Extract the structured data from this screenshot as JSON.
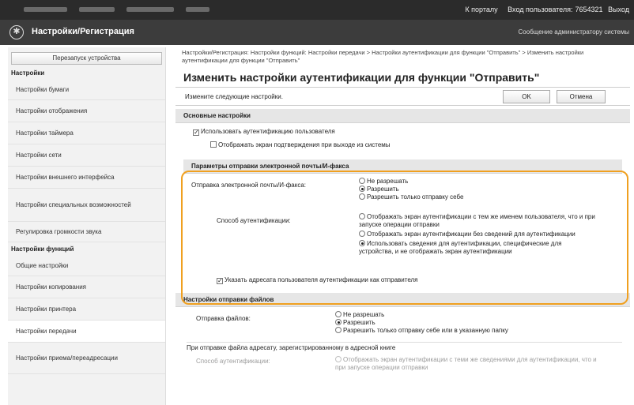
{
  "topbar": {
    "portal_link": "К порталу",
    "login_label": "Вход пользователя:",
    "login_user": "7654321",
    "logout_link": "Выход"
  },
  "app": {
    "title": "Настройки/Регистрация",
    "admin_message": "Сообщение администратору системы"
  },
  "sidebar": {
    "restart_button": "Перезапуск устройства",
    "section1": "Настройки",
    "items1": [
      "Настройки бумаги",
      "Настройки отображения",
      "Настройки таймера",
      "Настройки сети",
      "Настройки внешнего интерфейса",
      "Настройки специальных возможностей",
      "Регулировка громкости звука"
    ],
    "section2": "Настройки функций",
    "items2": [
      "Общие настройки",
      "Настройки копирования",
      "Настройки принтера",
      "Настройки передачи",
      "Настройки приема/переадресации"
    ]
  },
  "main": {
    "breadcrumb": "Настройки/Регистрация: Настройки функций: Настройки передачи > Настройки аутентификации для функции \"Отправить\" > Изменить настройки аутентификации для функции \"Отправить\"",
    "page_title": "Изменить настройки аутентификации для функции \"Отправить\"",
    "instruction": "Измените следующие настройки.",
    "ok_button": "OK",
    "cancel_button": "Отмена",
    "basic": {
      "header": "Основные настройки",
      "use_auth": "Использовать аутентификацию пользователя",
      "show_confirm": "Отображать экран подтверждения при выходе из системы"
    },
    "email": {
      "header": "Параметры отправки электронной почты/И-факса",
      "send_label": "Отправка электронной почты/И-факса:",
      "send_options": [
        "Не разрешать",
        "Разрешить",
        "Разрешить только отправку себе"
      ],
      "auth_label": "Способ аутентификации:",
      "auth_option1": "Отображать экран аутентификации с тем же именем пользователя, что и при запуске операции отправки",
      "auth_option2": "Отображать экран аутентификации без сведений для аутентификации",
      "auth_option3": "Использовать сведения для аутентификации, специфические для устройства, и не отображать экран аутентификации",
      "specify_sender": "Указать адресата пользователя аутентификации как отправителя"
    },
    "file": {
      "header": "Настройки отправки файлов",
      "send_label": "Отправка файлов:",
      "send_options": [
        "Не разрешать",
        "Разрешить",
        "Разрешить только отправку себе или в указанную папку"
      ],
      "note": "При отправке файла адресату, зарегистрированному в адресной книге",
      "auth_label": "Способ аутентификации:",
      "auth_option1": "Отображать экран аутентификации с теми же сведениями для аутентификации, что и при запуске операции отправки"
    }
  }
}
